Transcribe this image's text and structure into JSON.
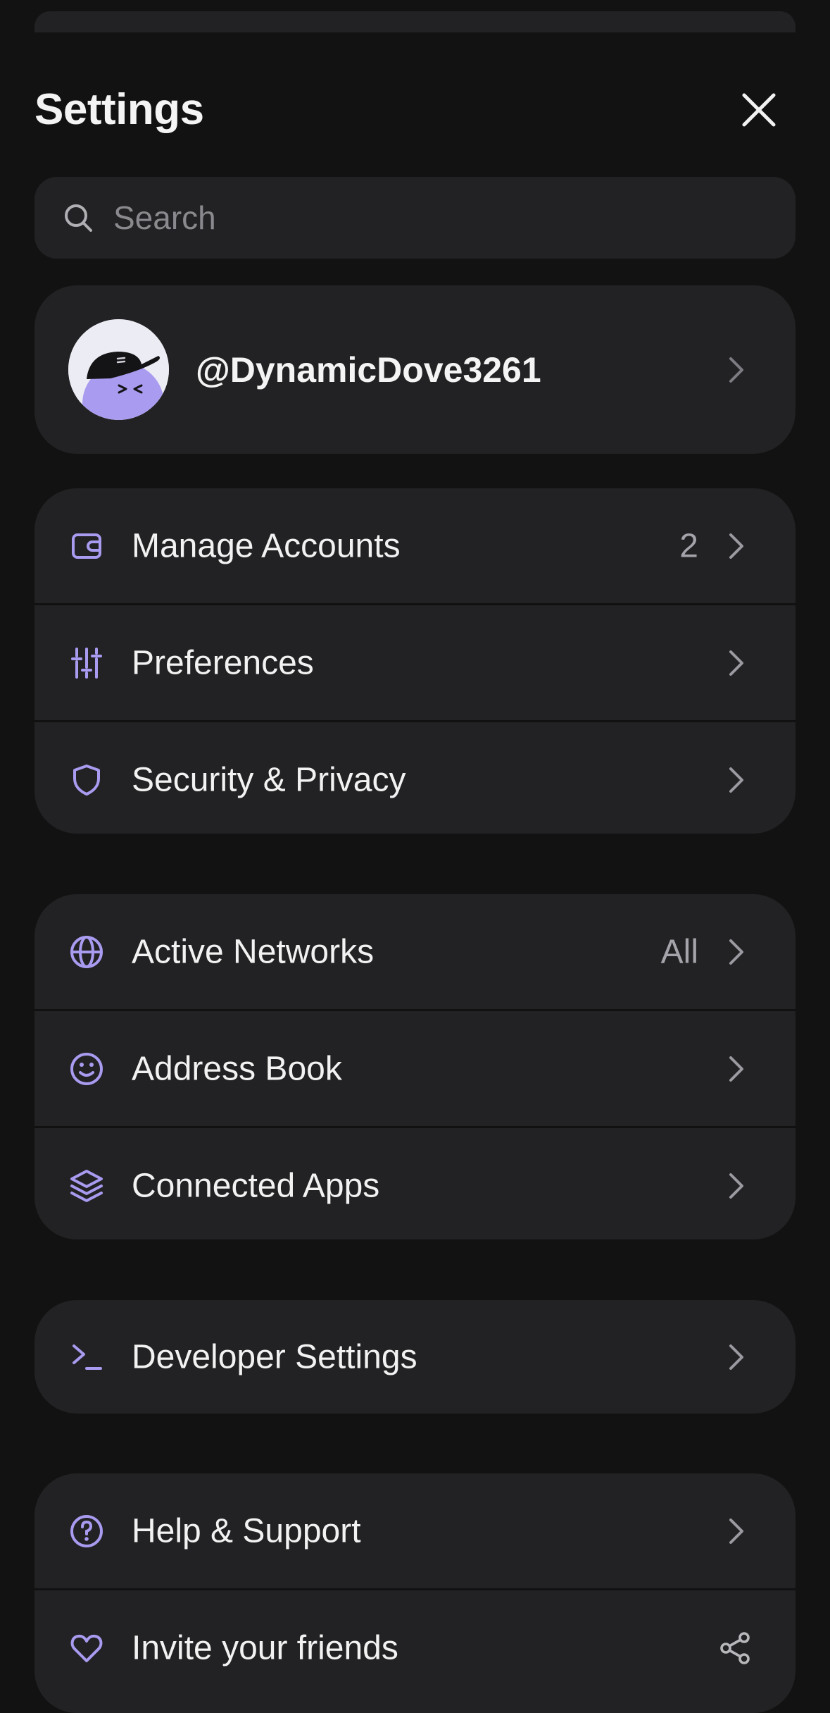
{
  "header": {
    "title": "Settings",
    "close_icon": "close-icon"
  },
  "search": {
    "placeholder": "Search",
    "value": "",
    "icon": "search-icon"
  },
  "profile": {
    "username": "@DynamicDove3261",
    "avatar": "avatar-bird-with-cap"
  },
  "colors": {
    "accent": "#A89BF0",
    "card": "#222224",
    "background": "#121212",
    "chevron": "#9a9aa0",
    "value_text": "#a4a4aa"
  },
  "groups": [
    {
      "items": [
        {
          "label": "Manage Accounts",
          "value": "2",
          "icon": "wallet-icon"
        },
        {
          "label": "Preferences",
          "value": "",
          "icon": "sliders-icon"
        },
        {
          "label": "Security & Privacy",
          "value": "",
          "icon": "shield-icon"
        }
      ]
    },
    {
      "items": [
        {
          "label": "Active Networks",
          "value": "All",
          "icon": "globe-icon"
        },
        {
          "label": "Address Book",
          "value": "",
          "icon": "smiley-icon"
        },
        {
          "label": "Connected Apps",
          "value": "",
          "icon": "layers-icon"
        }
      ]
    },
    {
      "items": [
        {
          "label": "Developer Settings",
          "value": "",
          "icon": "terminal-icon"
        }
      ]
    },
    {
      "items": [
        {
          "label": "Help & Support",
          "value": "",
          "icon": "help-circle-icon"
        },
        {
          "label": "Invite your friends",
          "value": "",
          "icon": "heart-icon",
          "trailing_icon": "share-icon"
        }
      ]
    }
  ]
}
